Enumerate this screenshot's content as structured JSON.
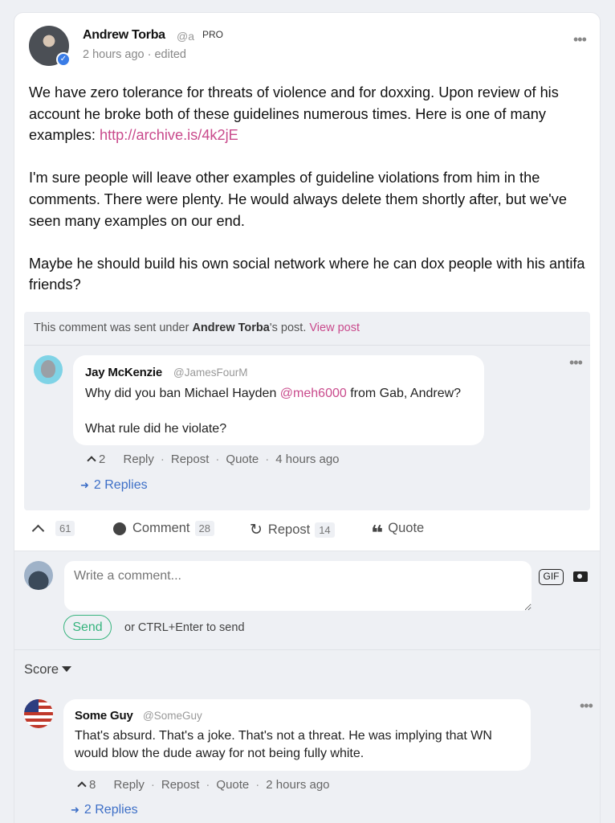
{
  "post": {
    "author_name": "Andrew Torba",
    "author_handle": "@a",
    "pro_badge": "PRO",
    "meta": "2 hours ago · edited",
    "paragraph1_text": "We have zero tolerance for threats of violence and for doxxing. Upon review of his account he broke both of these guidelines numerous times. Here is one of many examples: ",
    "paragraph1_link": "http://archive.is/4k2jE",
    "paragraph2": "I'm sure people will leave other examples of guideline violations from him in the comments. There were plenty. He would always delete them shortly after, but we've seen many examples on our end.",
    "paragraph3": "Maybe he should build his own social network where he can dox people with his antifa friends?",
    "more_icon": "•••"
  },
  "thread": {
    "note_prefix": "This comment was sent under ",
    "note_author": "Andrew Torba",
    "note_suffix": "'s post. ",
    "view_post": "View post",
    "comment": {
      "name": "Jay McKenzie",
      "handle": "@JamesFourM",
      "line1_prefix": "Why did you ban Michael Hayden ",
      "line1_mention": "@meh6000",
      "line1_suffix": " from Gab, Andrew?",
      "line2": "What rule did he violate?",
      "votes": "2",
      "reply": "Reply",
      "repost": "Repost",
      "quote": "Quote",
      "time": "4 hours ago",
      "replies": "2 Replies"
    }
  },
  "stats": {
    "likes": "61",
    "comment_label": "Comment",
    "comment_count": "28",
    "repost_label": "Repost",
    "repost_count": "14",
    "quote_label": "Quote"
  },
  "compose": {
    "placeholder": "Write a comment...",
    "gif": "GIF",
    "send": "Send",
    "hint": "or CTRL+Enter to send"
  },
  "sort": {
    "label": "Score"
  },
  "comment2": {
    "name": "Some Guy",
    "handle": "@SomeGuy",
    "text": "That's absurd. That's a joke. That's not a threat. He was implying that WN would blow the dude away for not being fully white.",
    "votes": "8",
    "reply": "Reply",
    "repost": "Repost",
    "quote": "Quote",
    "time": "2 hours ago",
    "replies": "2 Replies"
  },
  "colors": {
    "link": "#c94a8c",
    "replies": "#3d6fc7",
    "send": "#37b47e",
    "verified": "#3a7ce6"
  }
}
